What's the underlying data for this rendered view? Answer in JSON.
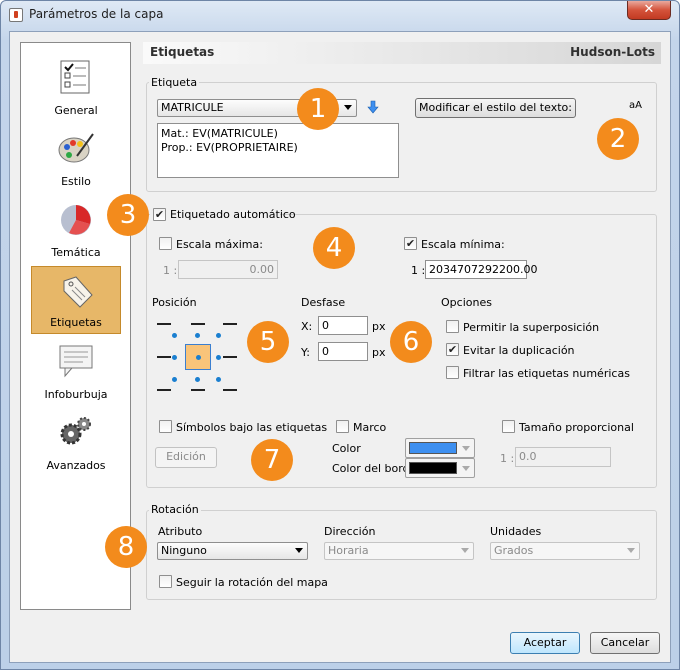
{
  "window": {
    "title": "Parámetros de la capa",
    "close": "✕"
  },
  "sidebar": {
    "items": [
      {
        "label": "General",
        "icon": "checklist-icon"
      },
      {
        "label": "Estilo",
        "icon": "palette-icon"
      },
      {
        "label": "Temática",
        "icon": "pie-chart-icon"
      },
      {
        "label": "Etiquetas",
        "icon": "label-tag-icon"
      },
      {
        "label": "Infoburbuja",
        "icon": "speech-bubble-icon"
      },
      {
        "label": "Avanzados",
        "icon": "gears-icon"
      }
    ],
    "selected": "Etiquetas"
  },
  "header": {
    "title": "Etiquetas",
    "layer": "Hudson-Lots"
  },
  "etiqueta": {
    "group": "Etiqueta",
    "field": "MATRICULE",
    "text_lines": [
      "Mat.: EV(MATRICULE)",
      "Prop.: EV(PROPRIETAIRE)"
    ],
    "style_button": "Modificar el estilo del texto:",
    "style_preview": "aA"
  },
  "auto": {
    "label": "Etiquetado automático",
    "checked": true
  },
  "scale": {
    "max_label": "Escala máxima:",
    "max_checked": false,
    "max_prefix": "1 :",
    "max_value": "0.00",
    "min_label": "Escala mínima:",
    "min_checked": true,
    "min_prefix": "1 :",
    "min_value": "2034707292200.00"
  },
  "position": {
    "label": "Posición"
  },
  "offset": {
    "label": "Desfase",
    "x_label": "X:",
    "x_value": "0",
    "y_label": "Y:",
    "y_value": "0",
    "unit": "px"
  },
  "options": {
    "label": "Opciones",
    "items": [
      {
        "label": "Permitir la superposición",
        "checked": false
      },
      {
        "label": "Evitar la duplicación",
        "checked": true
      },
      {
        "label": "Filtrar las etiquetas numéricas",
        "checked": false
      }
    ]
  },
  "symbols": {
    "label": "Símbolos bajo las etiquetas",
    "checked": false,
    "edit": "Edición"
  },
  "frame": {
    "label": "Marco",
    "checked": false,
    "color_label": "Color",
    "border_label": "Color del borde",
    "color": "#3d8ff0",
    "border_color": "#000000"
  },
  "proportional": {
    "label": "Tamaño proporcional",
    "checked": false,
    "prefix": "1 :",
    "value": "0.0"
  },
  "rotation": {
    "group": "Rotación",
    "attr_label": "Atributo",
    "attr_value": "Ninguno",
    "dir_label": "Dirección",
    "dir_value": "Horaria",
    "units_label": "Unidades",
    "units_value": "Grados",
    "follow_label": "Seguir la rotación del mapa",
    "follow_checked": false
  },
  "footer": {
    "accept": "Aceptar",
    "cancel": "Cancelar"
  },
  "badges": [
    "1",
    "2",
    "3",
    "4",
    "5",
    "6",
    "7",
    "8"
  ],
  "colors": {
    "badge": "#f38b1c",
    "selected_item": "#e7b768"
  }
}
